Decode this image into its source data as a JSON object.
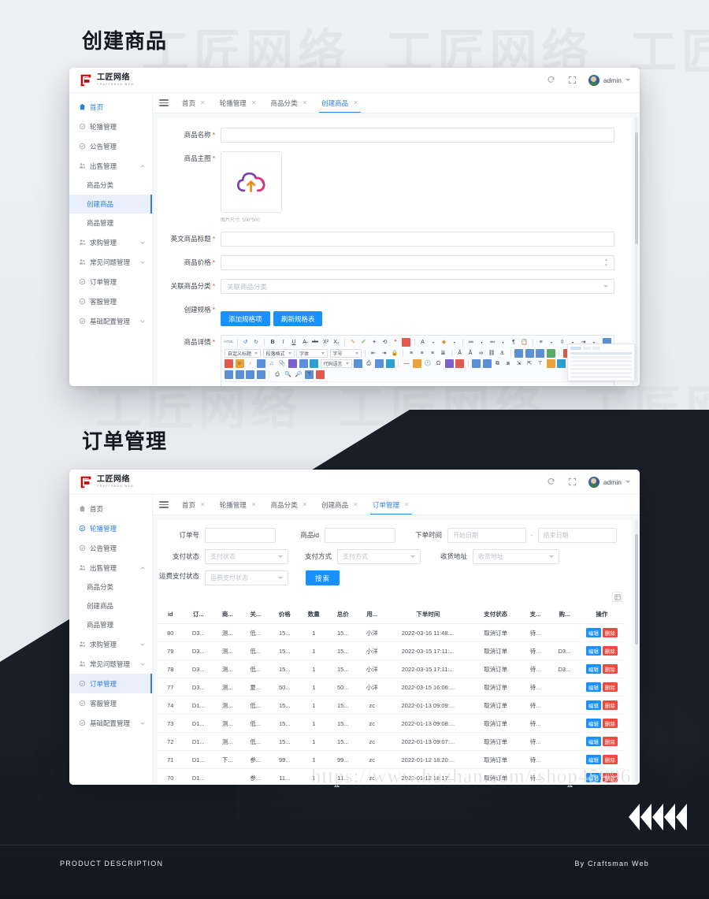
{
  "page": {
    "section_titles": [
      "创建商品",
      "订单管理"
    ],
    "bg_watermark": "工匠网络",
    "url_watermark": "https://www.huzhan.com/ishop45996",
    "footer_left": "PRODUCT DESCRIPTION",
    "footer_right": "By Craftsman Web",
    "accent_blue": "#1890ff",
    "active_blue": "#2f7fe0",
    "danger_red": "#ee4a41",
    "logo_red": "#cc0000"
  },
  "brand": {
    "name": "工匠网络",
    "sub": "CRAFTSMAN WEB"
  },
  "topbar": {
    "refresh_icon": "refresh-icon",
    "fullscreen_icon": "fullscreen-icon",
    "avatar_icon": "avatar",
    "user_name": "admin",
    "caret_icon": "chevron-down-icon"
  },
  "sidebar": {
    "items": [
      {
        "label": "首页",
        "icon": "home-icon",
        "state": "link"
      },
      {
        "label": "轮播管理",
        "icon": "shield-icon",
        "state": "normal"
      },
      {
        "label": "公告管理",
        "icon": "shield-icon",
        "state": "normal"
      },
      {
        "label": "出售管理",
        "icon": "users-icon",
        "state": "expanded",
        "arrow": "chevron-up-icon"
      },
      {
        "label": "求购管理",
        "icon": "users-icon",
        "state": "collapsed",
        "arrow": "chevron-down-icon"
      },
      {
        "label": "常见问题管理",
        "icon": "users-icon",
        "state": "collapsed",
        "arrow": "chevron-down-icon"
      },
      {
        "label": "订单管理",
        "icon": "shield-icon",
        "state": "normal"
      },
      {
        "label": "客服管理",
        "icon": "shield-icon",
        "state": "normal"
      },
      {
        "label": "基础配置管理",
        "icon": "shield-icon",
        "state": "collapsed",
        "arrow": "chevron-down-icon"
      }
    ],
    "sub_items": [
      "商品分类",
      "创建商品",
      "商品管理"
    ],
    "active_sub_w1": "创建商品",
    "active_item_w2": "订单管理",
    "hover_item_w2": "轮播管理"
  },
  "window1": {
    "tabs": [
      {
        "label": "首页",
        "closable": true,
        "active": false
      },
      {
        "label": "轮播管理",
        "closable": true,
        "active": false
      },
      {
        "label": "商品分类",
        "closable": true,
        "active": false
      },
      {
        "label": "创建商品",
        "closable": true,
        "active": true
      }
    ],
    "form": {
      "name_label": "商品名称",
      "name_value": "",
      "main_image_label": "商品主图",
      "upload_icon": "cloud-upload-icon",
      "image_hint": "图片尺寸: 500*500",
      "en_title_label": "英文商品标题",
      "en_title_value": "",
      "price_label": "商品价格",
      "price_value": "",
      "category_label": "关联商品分类",
      "category_placeholder": "关联商品分类",
      "spec_label": "创建规格",
      "add_spec_button": "添加规格项",
      "refresh_spec_button": "刷新规格表",
      "detail_label": "商品详情"
    },
    "editor": {
      "selects": [
        "自定义标题",
        "段落格式",
        "字体",
        "字号",
        "代码语言"
      ],
      "buttons_row1": [
        "HTML",
        "撤销",
        "重做",
        "加粗",
        "倾斜",
        "下划线",
        "删除线",
        "上标",
        "下标",
        "格式刷",
        "清除格式",
        "背景色",
        "字符",
        "引用",
        "字体颜色",
        "背景颜色",
        "有序列表",
        "无序列表",
        "分隔线",
        "粘贴",
        "对齐",
        "行距",
        "缩进"
      ],
      "buttons_row2": [
        "撤销缩进",
        "增加缩进",
        "锁定",
        "左对齐",
        "居中",
        "右对齐",
        "两端对齐",
        "搜索替换",
        "字数统计",
        "删除",
        "链接",
        "取消链接",
        "锚点",
        "图片",
        "附件",
        "地图",
        "背景"
      ],
      "buttons_row3": [
        "表情",
        "音乐",
        "视频",
        "附件",
        "地图",
        "百度应用",
        "代码",
        "模板",
        "分页",
        "时间",
        "日期",
        "特殊字符",
        "公式",
        "截图",
        "表格",
        "插入表格",
        "合并",
        "拆分",
        "删除行",
        "删除列",
        "表格属性",
        "背景"
      ],
      "buttons_row4": [
        "全屏",
        "源码",
        "打印",
        "预览",
        "查找替换",
        "帮助",
        "复制"
      ]
    }
  },
  "window2": {
    "tabs": [
      {
        "label": "首页",
        "closable": true,
        "active": false
      },
      {
        "label": "轮播管理",
        "closable": true,
        "active": false
      },
      {
        "label": "商品分类",
        "closable": true,
        "active": false
      },
      {
        "label": "创建商品",
        "closable": true,
        "active": false
      },
      {
        "label": "订单管理",
        "closable": true,
        "active": true
      }
    ],
    "search": {
      "order_no_label": "订单号",
      "order_no_value": "",
      "product_id_label": "商品id",
      "product_id_value": "",
      "order_time_label": "下单时间",
      "start_date_placeholder": "开始日期",
      "end_date_placeholder": "结束日期",
      "date_sep": "-",
      "pay_status_label": "支付状态",
      "pay_status_placeholder": "支付状态",
      "pay_method_label": "支付方式",
      "pay_method_placeholder": "支付方式",
      "address_label": "收货地址",
      "address_placeholder": "收货地址",
      "freight_status_label": "运费支付状态",
      "freight_status_placeholder": "运费支付状态",
      "search_button": "搜索",
      "column_settings_icon": "table-settings-icon"
    },
    "table": {
      "columns": [
        "id",
        "订...",
        "商...",
        "关...",
        "价格",
        "数量",
        "总价",
        "用...",
        "下单时间",
        "支付状态",
        "支...",
        "购...",
        "操作"
      ],
      "rows": [
        {
          "id": "80",
          "order": "D3...",
          "product": "测...",
          "rel": "低...",
          "price": "15...",
          "qty": "1",
          "total": "15...",
          "user": "小洋",
          "time": "2022-03-16 11:48:...",
          "pay_status": "取消订单",
          "ship": "待...",
          "buyer": "",
          "edit": "编辑",
          "del": "删除"
        },
        {
          "id": "79",
          "order": "D3...",
          "product": "测...",
          "rel": "低...",
          "price": "15...",
          "qty": "1",
          "total": "15...",
          "user": "小洋",
          "time": "2022-03-15 17:11:...",
          "pay_status": "取消订单",
          "ship": "待...",
          "buyer": "D3...",
          "edit": "编辑",
          "del": "删除"
        },
        {
          "id": "78",
          "order": "D3...",
          "product": "测...",
          "rel": "低...",
          "price": "15...",
          "qty": "1",
          "total": "15...",
          "user": "小洋",
          "time": "2022-03-15 17:11:...",
          "pay_status": "取消订单",
          "ship": "待...",
          "buyer": "D3...",
          "edit": "编辑",
          "del": "删除"
        },
        {
          "id": "77",
          "order": "D3...",
          "product": "测...",
          "rel": "夏...",
          "price": "50...",
          "qty": "1",
          "total": "50...",
          "user": "小洋",
          "time": "2022-03-15 16:06:...",
          "pay_status": "取消订单",
          "ship": "待...",
          "buyer": "",
          "edit": "编辑",
          "del": "删除"
        },
        {
          "id": "74",
          "order": "D1...",
          "product": "测...",
          "rel": "低...",
          "price": "15...",
          "qty": "1",
          "total": "15...",
          "user": "zc",
          "time": "2022-01-13 09:09:...",
          "pay_status": "取消订单",
          "ship": "待...",
          "buyer": "",
          "edit": "编辑",
          "del": "删除"
        },
        {
          "id": "73",
          "order": "D1...",
          "product": "测...",
          "rel": "低...",
          "price": "15...",
          "qty": "1",
          "total": "15...",
          "user": "zc",
          "time": "2022-01-13 09:08:...",
          "pay_status": "取消订单",
          "ship": "待...",
          "buyer": "",
          "edit": "编辑",
          "del": "删除"
        },
        {
          "id": "72",
          "order": "D1...",
          "product": "测...",
          "rel": "低...",
          "price": "15...",
          "qty": "1",
          "total": "15...",
          "user": "zc",
          "time": "2022-01-13 09:07:...",
          "pay_status": "取消订单",
          "ship": "待...",
          "buyer": "",
          "edit": "编辑",
          "del": "删除"
        },
        {
          "id": "71",
          "order": "D1...",
          "product": "下...",
          "rel": "参...",
          "price": "99...",
          "qty": "1",
          "total": "99...",
          "user": "zc",
          "time": "2022-01-12 18:20:...",
          "pay_status": "取消订单",
          "ship": "待...",
          "buyer": "",
          "edit": "编辑",
          "del": "删除"
        },
        {
          "id": "70",
          "order": "D1...",
          "product": "",
          "rel": "参...",
          "price": "11...",
          "qty": "1",
          "total": "11...",
          "user": "zc",
          "time": "2022-01-12 18:17:...",
          "pay_status": "取消订单",
          "ship": "待...",
          "buyer": "",
          "edit": "编辑",
          "del": "删除"
        }
      ]
    }
  }
}
